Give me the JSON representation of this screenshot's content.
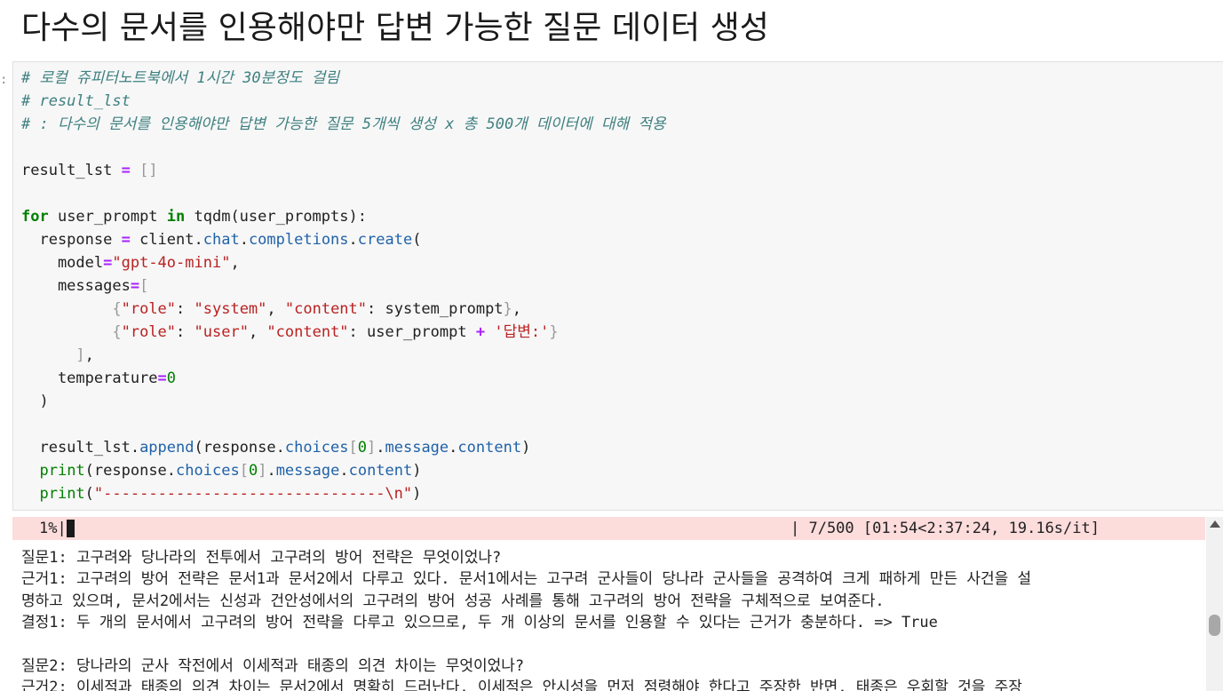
{
  "markdown": {
    "title": "다수의 문서를 인용해야만 답변 가능한 질문 데이터 생성"
  },
  "code_cell": {
    "indicator": ":",
    "comment1": "# 로컬 쥬피터노트북에서 1시간 30분정도 걸림",
    "comment2": "# result_lst",
    "comment3": "# : 다수의 문서를 인용해야만 답변 가능한 질문 5개씩 생성 x 총 500개 데이터에 대해 적용",
    "model_value": "\"gpt-4o-mini\"",
    "role_key": "\"role\"",
    "system_value": "\"system\"",
    "user_value": "\"user\"",
    "content_key": "\"content\"",
    "answer_suffix": "'답변:'",
    "separator_string": "\"-------------------------------\\n\""
  },
  "progress": {
    "percent": "1%|",
    "fraction_done": 0.014,
    "stats": "| 7/500 [01:54<2:37:24, 19.16s/it]"
  },
  "output": {
    "lines": [
      "질문1: 고구려와 당나라의 전투에서 고구려의 방어 전략은 무엇이었나?",
      "근거1: 고구려의 방어 전략은 문서1과 문서2에서 다루고 있다. 문서1에서는 고구려 군사들이 당나라 군사들을 공격하여 크게 패하게 만든 사건을 설",
      "명하고 있으며, 문서2에서는 신성과 건안성에서의 고구려의 방어 성공 사례를 통해 고구려의 방어 전략을 구체적으로 보여준다.",
      "결정1: 두 개의 문서에서 고구려의 방어 전략을 다루고 있으므로, 두 개 이상의 문서를 인용할 수 있다는 근거가 충분하다. => True",
      "",
      "질문2: 당나라의 군사 작전에서 이세적과 태종의 의견 차이는 무엇이었나?",
      "근거2: 이세적과 태종의 의견 차이는 문서2에서 명확히 드러난다. 이세적은 안시성을 먼저 점령해야 한다고 주장한 반면, 태종은 우회할 것을 주장"
    ]
  }
}
